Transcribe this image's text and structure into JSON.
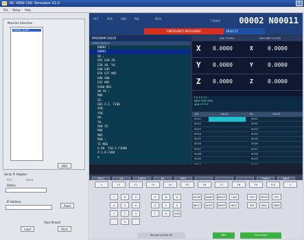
{
  "window": {
    "title": "NC VIEW CNC Simulator V2.0"
  },
  "menu": [
    "File",
    "Setup",
    "Help"
  ],
  "machine_selection": {
    "label": "Machine Selection",
    "selected": "FANUC 0i-MC"
  },
  "buttons": {
    "add": "ADD",
    "read": "Read",
    "load": "Load",
    "start": "Start"
  },
  "serial": {
    "label": "Serial IF Adapter",
    "port_label": "Port",
    "baud_label": "Baud",
    "status_label": "Status"
  },
  "ip": {
    "label": "IP Address",
    "auto_reload": "Auto Reload"
  },
  "cnc": {
    "register": "00002 N00011",
    "top_info": [
      "ACT",
      "POS",
      "ABS",
      "REL",
      "MCH"
    ],
    "top_small": "T 00/01",
    "alarm": "EMERGENCY MACHINING",
    "alarm2": "19:01:17",
    "program_title": "PROGRAM CHECK",
    "program_header": "O0002 N00011",
    "program_lines": [
      "O0002 ;",
      "G0001",
      "G0 ;",
      "G91 G28 Z0.",
      "G28 X0. Y0.",
      "G40 G49",
      "G54 G17 M05",
      "G90 G00",
      "G43 H01",
      "S500 M03",
      "X0 Y0 ;",
      "M08",
      "Z5.",
      "G01 Z-2. F100",
      "X50.",
      "Y50.",
      "X0.",
      "Y0.",
      "G00 Z5.",
      "M09",
      "M05",
      "M30 ;",
      "T1 M06",
      "X-40. Y10.5 F1000",
      "Z-1.0 F100",
      "%"
    ],
    "axes_header": [
      "ABS COORD",
      "MACHINE COORD"
    ],
    "axes": [
      {
        "name": "X",
        "value": "0.0000",
        "value2": "0.0000"
      },
      {
        "name": "Y",
        "value": "0.0000",
        "value2": "0.0000"
      },
      {
        "name": "Z",
        "value": "0.0000",
        "value2": "0.0000"
      }
    ],
    "info_lines": [
      "F 0  S 0  T 0",
      "MEM  STRT  MTN",
      "ALM  ***  ***"
    ],
    "tool_header": [
      "NO.",
      "VALUE",
      "NO.",
      "VALUE"
    ],
    "tool_rows": [
      "W001",
      "W002",
      "W003",
      "W004",
      "W005",
      "W006",
      "W007",
      "W008",
      "W009",
      "W010"
    ],
    "softkeys": [
      "PROG",
      "LIB",
      "CHECK",
      "BG",
      "OPRT",
      "",
      "",
      "",
      "+INPUT",
      "INPUT"
    ]
  },
  "keypad": {
    "row1": [
      "<",
      "F1",
      "F2",
      "F3",
      "F4",
      "F5",
      "F6",
      "F7",
      "F8",
      "F9",
      "F10",
      ">"
    ],
    "nums": [
      "7",
      "8",
      "9",
      "4",
      "5",
      "6",
      "1",
      "2",
      "3",
      "-",
      "0",
      "."
    ],
    "addr": [
      "O",
      "N",
      "G",
      "X",
      "Y",
      "Z",
      "F",
      "H",
      "EOB"
    ],
    "edit": [
      "ALTER",
      "INSRT",
      "DELET",
      "CAN",
      "INPUT",
      "SHIFT",
      "RESET",
      "HELP"
    ],
    "side": [
      "POS",
      "PROG",
      "OFS",
      "SYS",
      "MSG",
      "GRPH"
    ]
  },
  "statusbar": {
    "left": "Remote control for",
    "mid": "DNC",
    "right": "Connected"
  }
}
